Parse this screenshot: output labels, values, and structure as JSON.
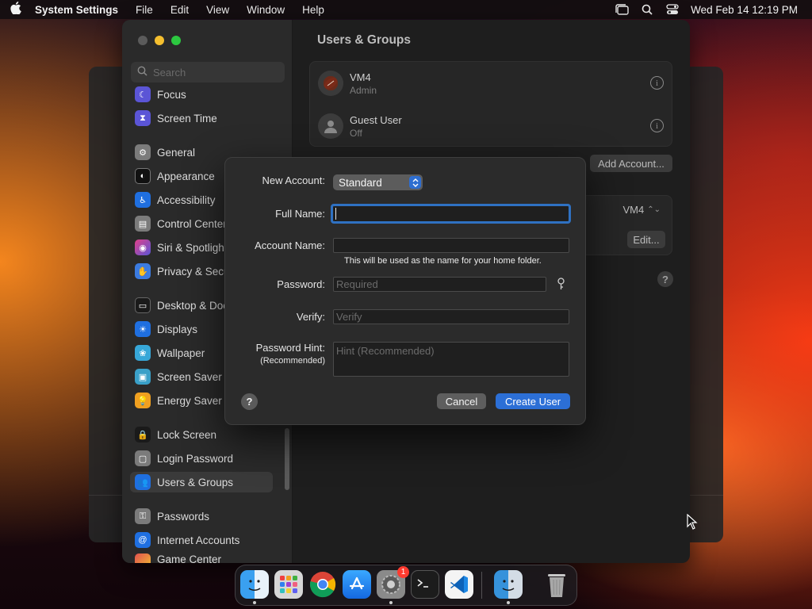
{
  "menubar": {
    "app_name": "System Settings",
    "items": [
      "File",
      "Edit",
      "View",
      "Window",
      "Help"
    ],
    "clock": "Wed Feb 14  12:19 PM"
  },
  "sidebar": {
    "search_placeholder": "Search",
    "items": [
      {
        "label": "Focus",
        "icon": "moon-icon",
        "color": "#5b55d6"
      },
      {
        "label": "Screen Time",
        "icon": "hourglass-icon",
        "color": "#5b55d6"
      },
      {
        "label": "General",
        "icon": "gear-icon",
        "color": "#8a8a8a"
      },
      {
        "label": "Appearance",
        "icon": "appearance-icon",
        "color": "#2a2a2a"
      },
      {
        "label": "Accessibility",
        "icon": "accessibility-icon",
        "color": "#1f6fe0"
      },
      {
        "label": "Control Center",
        "icon": "control-center-icon",
        "color": "#8a8a8a"
      },
      {
        "label": "Siri & Spotlight",
        "icon": "siri-icon",
        "color": "#c03ad0"
      },
      {
        "label": "Privacy & Security",
        "icon": "hand-icon",
        "color": "#3b7be0"
      },
      {
        "label": "Desktop & Dock",
        "icon": "dock-icon",
        "color": "#2a2a2a"
      },
      {
        "label": "Displays",
        "icon": "displays-icon",
        "color": "#1f6fe0"
      },
      {
        "label": "Wallpaper",
        "icon": "wallpaper-icon",
        "color": "#37a7d8"
      },
      {
        "label": "Screen Saver",
        "icon": "screen-saver-icon",
        "color": "#3aa0c8"
      },
      {
        "label": "Energy Saver",
        "icon": "battery-icon",
        "color": "#f0a020"
      },
      {
        "label": "Lock Screen",
        "icon": "lock-icon",
        "color": "#2a2a2a"
      },
      {
        "label": "Login Password",
        "icon": "login-password-icon",
        "color": "#8a8a8a"
      },
      {
        "label": "Users & Groups",
        "icon": "users-icon",
        "color": "#1f6fe0"
      },
      {
        "label": "Passwords",
        "icon": "key-icon",
        "color": "#8a8a8a"
      },
      {
        "label": "Internet Accounts",
        "icon": "at-icon",
        "color": "#1f6fe0"
      },
      {
        "label": "Game Center",
        "icon": "game-center-icon",
        "color": "#e05050"
      }
    ]
  },
  "content": {
    "title": "Users & Groups",
    "users": [
      {
        "name": "VM4",
        "role": "Admin"
      },
      {
        "name": "Guest User",
        "role": "Off"
      }
    ],
    "add_account_label": "Add Account...",
    "auto_login_value": "VM4",
    "edit_label": "Edit..."
  },
  "dialog": {
    "new_account_label": "New Account:",
    "account_type": "Standard",
    "full_name_label": "Full Name:",
    "full_name_value": "",
    "account_name_label": "Account Name:",
    "account_name_value": "",
    "account_name_note": "This will be used as the name for your home folder.",
    "password_label": "Password:",
    "password_placeholder": "Required",
    "verify_label": "Verify:",
    "verify_placeholder": "Verify",
    "hint_label": "Password Hint:",
    "hint_sublabel": "(Recommended)",
    "hint_placeholder": "Hint (Recommended)",
    "help_label": "?",
    "cancel_label": "Cancel",
    "create_label": "Create User"
  },
  "dock": {
    "apps": [
      {
        "name": "finder-icon",
        "running": true
      },
      {
        "name": "launchpad-icon",
        "running": false
      },
      {
        "name": "chrome-icon",
        "running": false
      },
      {
        "name": "app-store-icon",
        "running": false
      },
      {
        "name": "system-settings-icon",
        "running": true,
        "badge": "1"
      },
      {
        "name": "terminal-icon",
        "running": false
      },
      {
        "name": "vscode-icon",
        "running": false
      },
      {
        "name": "finder-recent-icon",
        "running": true
      },
      {
        "name": "trash-icon",
        "running": false
      }
    ]
  },
  "colors": {
    "accent": "#2c6fd6",
    "badge": "#ff3b30",
    "traffic_min": "#f5bf2f",
    "traffic_max": "#2cc840"
  }
}
